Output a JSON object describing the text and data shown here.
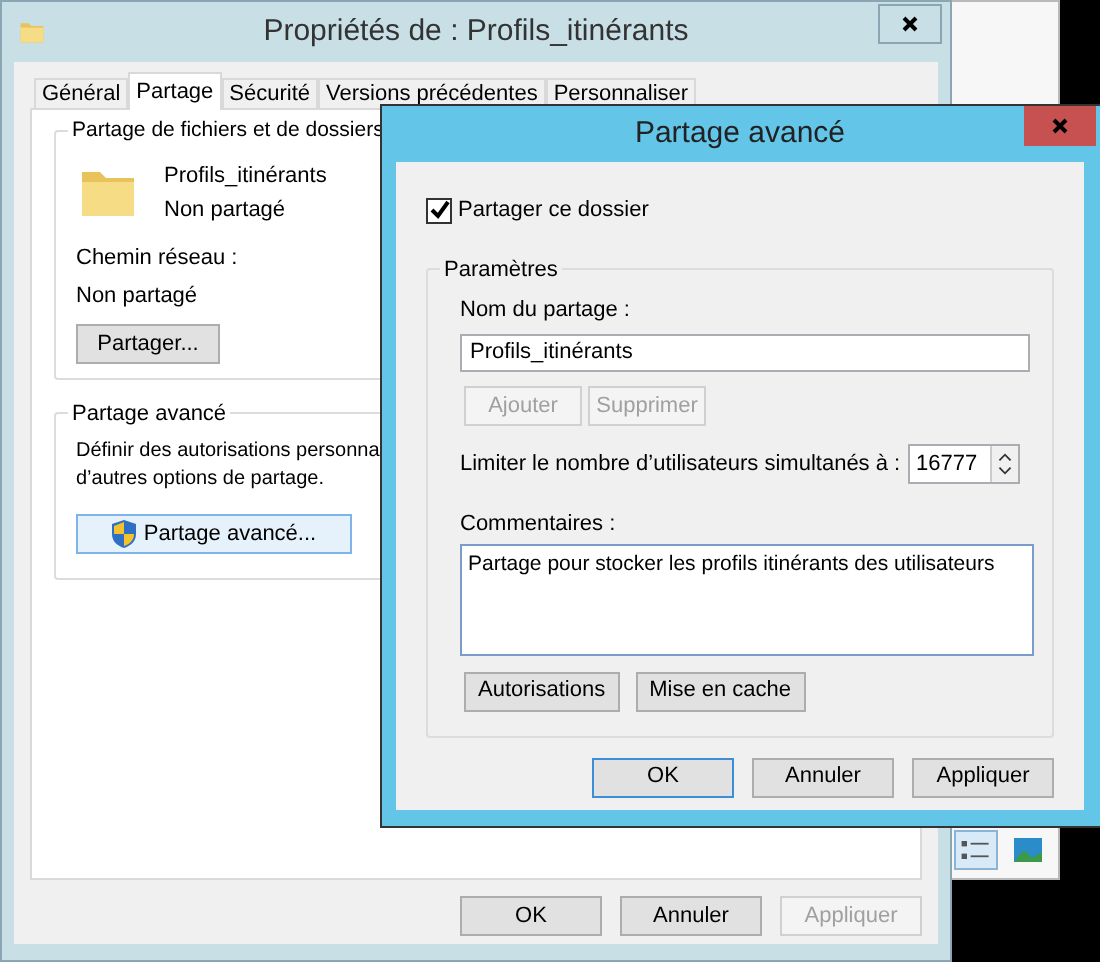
{
  "properties_window": {
    "title": "Propriétés de : Profils_itinérants",
    "tabs": [
      {
        "label": "Général",
        "selected": false
      },
      {
        "label": "Partage",
        "selected": true
      },
      {
        "label": "Sécurité",
        "selected": false
      },
      {
        "label": "Versions précédentes",
        "selected": false
      },
      {
        "label": "Personnaliser",
        "selected": false
      }
    ],
    "file_sharing_group": {
      "title": "Partage de fichiers et de dossiers",
      "folder_name": "Profils_itinérants",
      "folder_status": "Non partagé",
      "network_path_label": "Chemin réseau :",
      "network_path": "Non partagé",
      "share_button": "Partager..."
    },
    "advanced_group": {
      "title": "Partage avancé",
      "description_lines": [
        "Définir des autorisations personna",
        "d’autres options de partage."
      ],
      "button": "Partage avancé..."
    },
    "buttons": [
      {
        "label": "OK",
        "disabled": false
      },
      {
        "label": "Annuler",
        "disabled": false
      },
      {
        "label": "Appliquer",
        "disabled": true
      }
    ]
  },
  "advanced_dialog": {
    "title": "Partage avancé",
    "share_checkbox": {
      "label": "Partager ce dossier",
      "checked": true
    },
    "settings_group": {
      "title": "Paramètres",
      "share_name_label": "Nom du partage :",
      "share_name_value": "Profils_itinérants",
      "name_buttons": [
        {
          "label": "Ajouter",
          "disabled": true
        },
        {
          "label": "Supprimer",
          "disabled": true
        }
      ],
      "user_limit_label": "Limiter le nombre d’utilisateurs simultanés à :",
      "user_limit_value": "16777",
      "comments_label": "Commentaires :",
      "comments_value": "Partage pour stocker les profils itinérants des utilisateurs",
      "buttons": [
        {
          "label": "Autorisations",
          "disabled": false
        },
        {
          "label": "Mise en cache",
          "disabled": false
        }
      ]
    },
    "buttons": [
      {
        "label": "OK",
        "default": true
      },
      {
        "label": "Annuler",
        "default": false
      },
      {
        "label": "Appliquer",
        "default": false
      }
    ]
  }
}
